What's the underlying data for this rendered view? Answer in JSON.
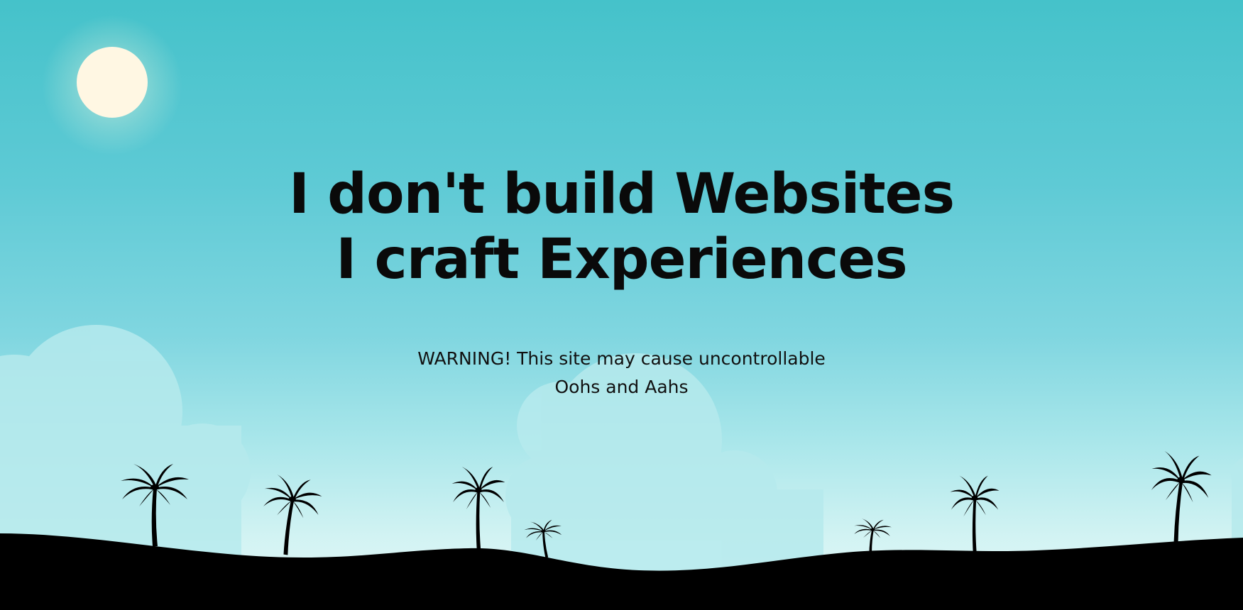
{
  "hero": {
    "headline_line1": "I don't build Websites",
    "headline_line2": "I craft Experiences",
    "warning_line1": "WARNING! This site may cause uncontrollable",
    "warning_line2": "Oohs and Aahs"
  },
  "colors": {
    "sky_top": "#45c2ca",
    "sky_bottom": "#e6f9f8",
    "sun": "#fff7e3",
    "ground": "#000000",
    "text": "#0a0a0a"
  },
  "icons": [
    "sun-icon",
    "cloud-icon",
    "palm-tree-icon",
    "hill-silhouette"
  ]
}
